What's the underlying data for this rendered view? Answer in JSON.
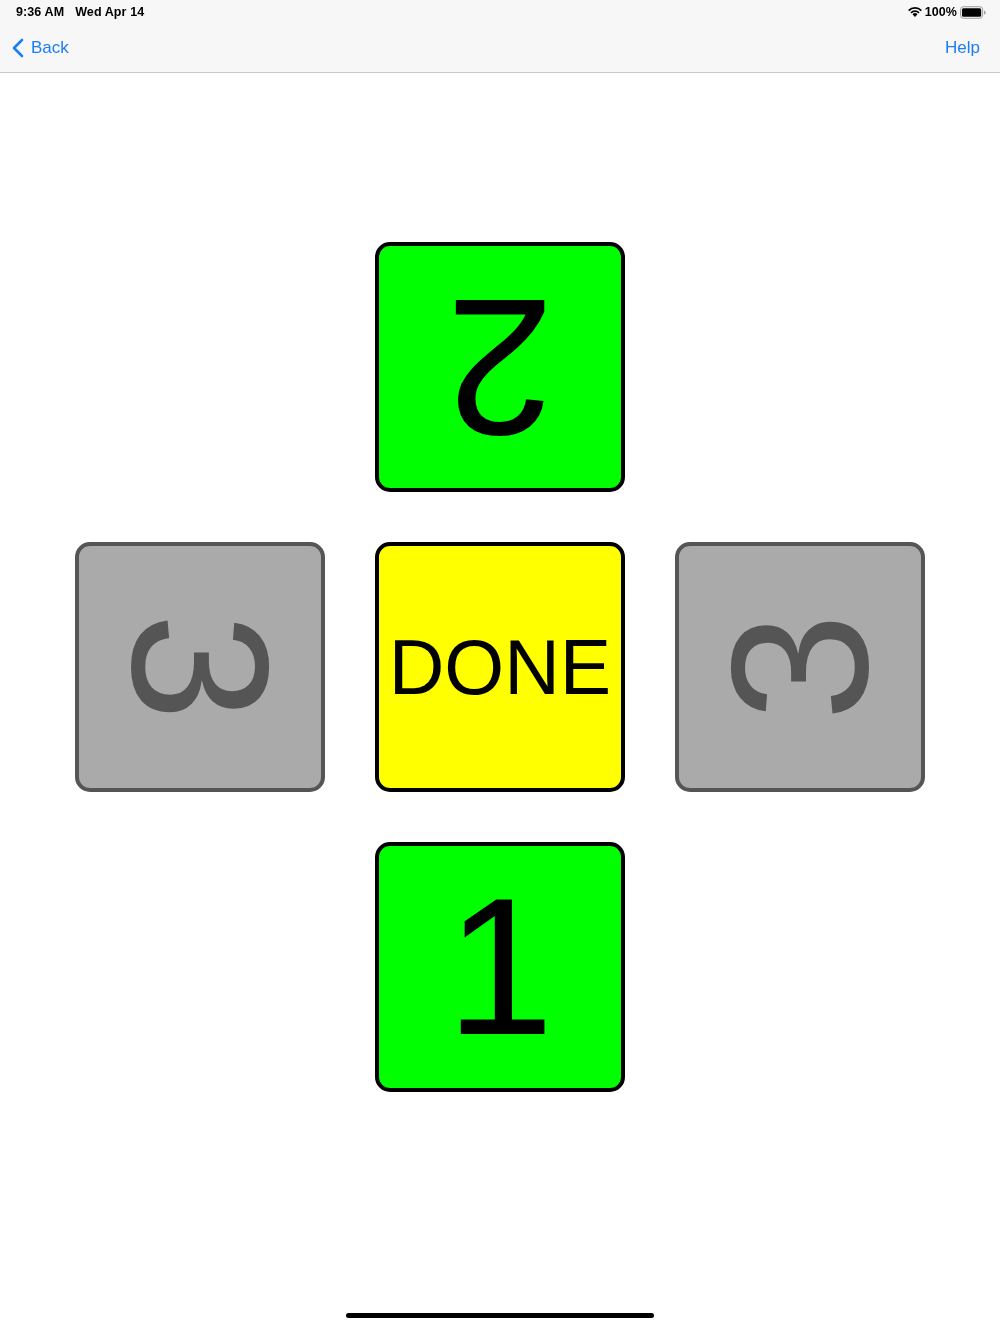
{
  "status_bar": {
    "time": "9:36 AM",
    "date": "Wed Apr 14",
    "battery": "100%"
  },
  "nav_bar": {
    "back": "Back",
    "help": "Help"
  },
  "rows": [
    [
      {
        "label": "2",
        "color": "#00ff00",
        "disabled": false,
        "kind": "inverted"
      }
    ],
    [
      {
        "label": "3",
        "color": "#aaaaaa",
        "disabled": true,
        "kind": "clockwise"
      },
      {
        "label": "DONE",
        "color": "#ffff00",
        "disabled": false,
        "kind": "upright"
      },
      {
        "label": "3",
        "color": "#aaaaaa",
        "disabled": true,
        "kind": "counterclockwise"
      }
    ],
    [
      {
        "label": "1",
        "color": "#00ff00",
        "disabled": false,
        "kind": "upright"
      }
    ]
  ]
}
